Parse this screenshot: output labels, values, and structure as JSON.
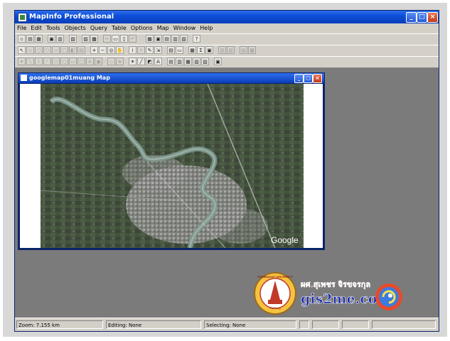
{
  "app": {
    "title": "MapInfo Professional"
  },
  "window_controls": {
    "minimize": "_",
    "maximize": "□",
    "close": "×"
  },
  "menu": [
    "File",
    "Edit",
    "Tools",
    "Objects",
    "Query",
    "Table",
    "Options",
    "Map",
    "Window",
    "Help"
  ],
  "map_window": {
    "title": "googlemap01muang Map",
    "watermark": "Google"
  },
  "branding": {
    "logo_text": "gis2me.com",
    "author_thai": "ผศ.สุเพชร จิรขจรกุล",
    "seal_ring_text": "THAMMASAT UNIVERSITY",
    "seal_banner": "Pa Pong"
  },
  "status": {
    "zoom": "Zoom: 7.155 km",
    "editing": "Editing: None",
    "selecting": "Selecting: None"
  },
  "colors": {
    "titlebar": "#0a3db8",
    "workspace": "#7b7b7b",
    "chrome": "#d4d0c8",
    "logo_blue": "#1a2aa8"
  }
}
